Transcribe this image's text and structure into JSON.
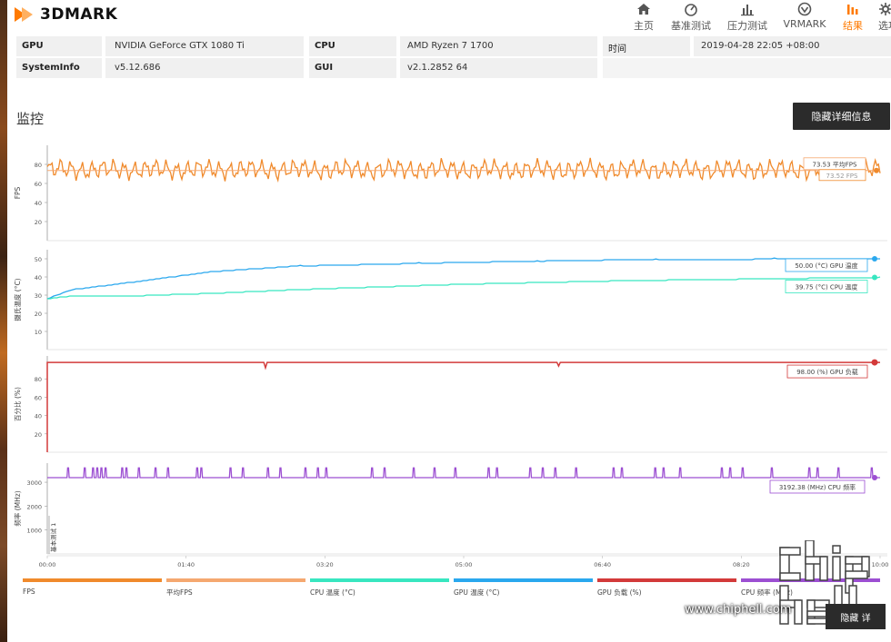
{
  "app": {
    "name": "3DMARK"
  },
  "nav": {
    "items": [
      {
        "label": "主页",
        "icon": "home-icon"
      },
      {
        "label": "基准测试",
        "icon": "gauge-icon"
      },
      {
        "label": "压力测试",
        "icon": "bars-icon"
      },
      {
        "label": "VRMARK",
        "icon": "vr-icon"
      },
      {
        "label": "结果",
        "icon": "results-icon",
        "active": true
      },
      {
        "label": "选项",
        "icon": "gear-icon"
      }
    ]
  },
  "info": {
    "gpu_label": "GPU",
    "gpu_value": "NVIDIA GeForce GTX 1080 Ti",
    "sysinfo_label": "SystemInfo",
    "sysinfo_value": "v5.12.686",
    "cpu_label": "CPU",
    "cpu_value": "AMD Ryzen 7 1700",
    "gui_label": "GUI",
    "gui_value": "v2.1.2852 64",
    "time_label": "时间",
    "time_value": "2019-04-28 22:05 +08:00"
  },
  "monitor": {
    "title": "监控",
    "details_button": "隐藏详细信息",
    "bottom_button": "隐藏 详"
  },
  "colors": {
    "fps": "#f08a2c",
    "avg_fps": "#f5a870",
    "cpu_temp": "#38e6c0",
    "gpu_temp": "#2aa8ee",
    "gpu_load": "#d33a3a",
    "cpu_freq": "#9c4fd2"
  },
  "chart_data": [
    {
      "type": "line",
      "ylabel": "FPS",
      "yticks": [
        20,
        40,
        60,
        80
      ],
      "ylim": [
        0,
        100
      ],
      "series": [
        {
          "name": "FPS",
          "pattern": "oscillating",
          "range": [
            62,
            87
          ]
        },
        {
          "name": "平均FPS",
          "values": [
            73.53
          ]
        }
      ],
      "annotations": [
        "73.53 平均FPS",
        "73.52 FPS"
      ]
    },
    {
      "type": "line",
      "ylabel": "摄氏温度 (°C)",
      "yticks": [
        10,
        20,
        30,
        40,
        50
      ],
      "ylim": [
        0,
        55
      ],
      "series": [
        {
          "name": "GPU 温度 (°C)",
          "x": [
            0,
            0.3,
            1,
            2,
            3,
            5,
            7,
            10
          ],
          "values": [
            28,
            33,
            37,
            43,
            46,
            48,
            49.5,
            50
          ]
        },
        {
          "name": "CPU 温度 (°C)",
          "x": [
            0,
            0.3,
            1,
            2,
            3,
            5,
            7,
            10
          ],
          "values": [
            28,
            29.5,
            29.5,
            31,
            33,
            36,
            38,
            39.75
          ]
        }
      ],
      "annotations": [
        "50.00 (°C) GPU 温度",
        "39.75 (°C) CPU 温度"
      ]
    },
    {
      "type": "line",
      "ylabel": "百分比 (%)",
      "yticks": [
        20,
        40,
        60,
        80
      ],
      "ylim": [
        0,
        105
      ],
      "series": [
        {
          "name": "GPU 负载 (%)",
          "x": [
            0,
            0.05,
            10
          ],
          "values": [
            0,
            98,
            98
          ]
        }
      ],
      "annotations": [
        "98.00 (%) GPU 负载"
      ]
    },
    {
      "type": "line",
      "ylabel": "频率 (MHz)",
      "yticks": [
        1000,
        2000,
        3000
      ],
      "ylim": [
        0,
        3800
      ],
      "series": [
        {
          "name": "CPU 频率 (MHz)",
          "baseline": 3192.38,
          "spikes_to": 3600
        }
      ],
      "annotations": [
        "3192.38 (MHz) CPU 频率"
      ],
      "marker_label": "基本测试 1"
    }
  ],
  "xaxis": {
    "ticks": [
      "00:00",
      "01:40",
      "03:20",
      "05:00",
      "06:40",
      "08:20",
      "10:00"
    ],
    "range_seconds": [
      0,
      600
    ]
  },
  "legend": [
    {
      "label": "FPS",
      "color": "#f08a2c"
    },
    {
      "label": "平均FPS",
      "color": "#f5a870"
    },
    {
      "label": "CPU 温度 (°C)",
      "color": "#38e6c0"
    },
    {
      "label": "GPU 温度 (°C)",
      "color": "#2aa8ee"
    },
    {
      "label": "GPU 负载 (%)",
      "color": "#d33a3a"
    },
    {
      "label": "CPU 频率 (MHz)",
      "color": "#9c4fd2"
    }
  ],
  "watermark": {
    "text": "www.chiphell.com",
    "logo": "chiphell-logo"
  }
}
